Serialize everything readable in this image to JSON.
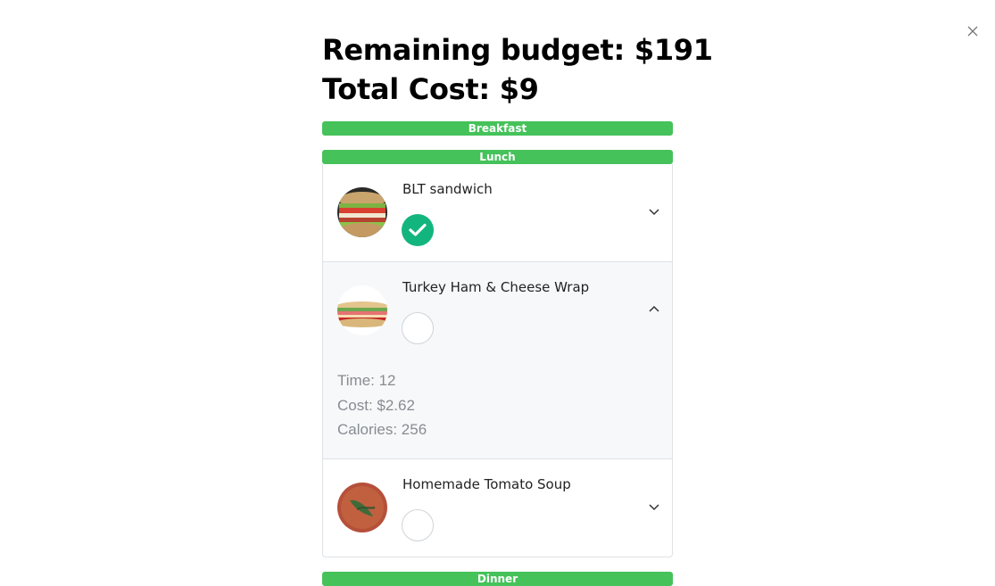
{
  "header": {
    "remaining_budget": "Remaining budget: $191",
    "total_cost": "Total Cost: $9"
  },
  "meals": {
    "breakfast": "Breakfast",
    "lunch": "Lunch",
    "dinner": "Dinner"
  },
  "lunch_items": [
    {
      "name": "BLT sandwich",
      "selected": true,
      "expanded": false
    },
    {
      "name": "Turkey Ham & Cheese Wrap",
      "selected": false,
      "expanded": true,
      "time": "Time: 12",
      "cost": "Cost: $2.62",
      "calories": "Calories: 256"
    },
    {
      "name": "Homemade Tomato Soup",
      "selected": false,
      "expanded": false
    }
  ],
  "colors": {
    "meal_bar": "#45c25a",
    "selected_check": "#13b57f",
    "detail_text": "#878c91"
  }
}
